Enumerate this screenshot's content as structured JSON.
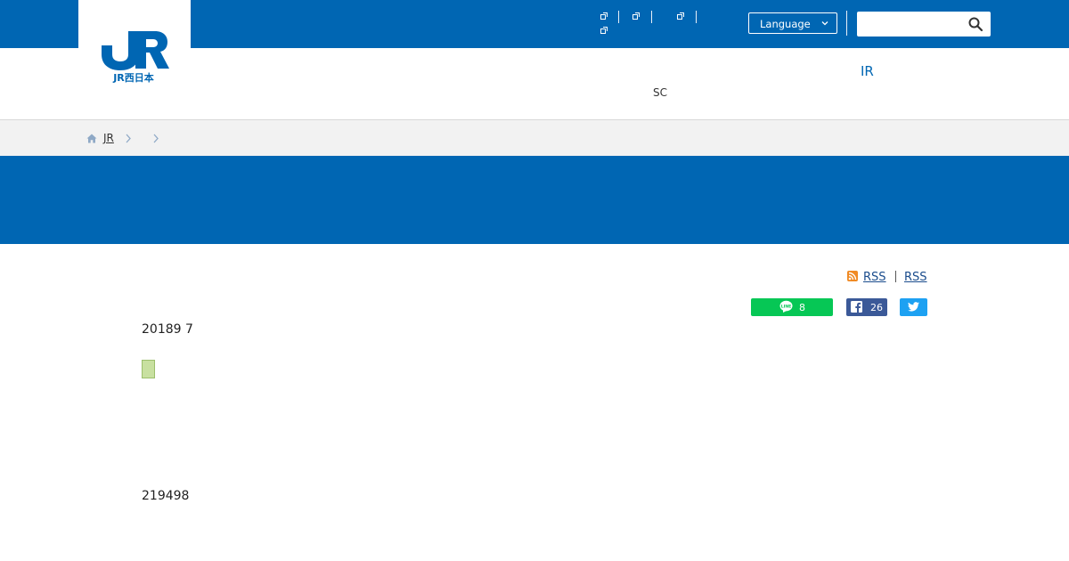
{
  "header": {
    "logo_text": "JR西日本",
    "language_label": "Language",
    "search": {
      "placeholder": "",
      "value": ""
    },
    "nav": {
      "sc_label": "SC",
      "ir_label": "IR"
    }
  },
  "breadcrumb": {
    "home_label": "JR"
  },
  "rss": {
    "label_1": "RSS",
    "label_2": "RSS"
  },
  "share": {
    "line_count": "8",
    "facebook_count": "26"
  },
  "content": {
    "date": "20189 7",
    "number": "219498"
  },
  "colors": {
    "brand_blue": "#0066b3",
    "line_green": "#06c755",
    "facebook_blue": "#3b5998",
    "twitter_blue": "#1da1f2",
    "tag_green": "#c8e0a0"
  },
  "icons": [
    "external-link-icon",
    "chevron-down-icon",
    "search-icon",
    "home-icon",
    "chevron-right-icon",
    "rss-icon",
    "line-icon",
    "facebook-icon",
    "twitter-icon"
  ]
}
